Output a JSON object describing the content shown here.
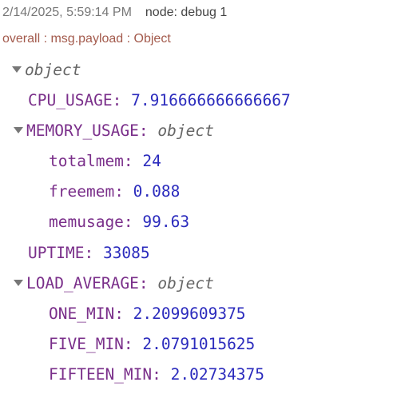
{
  "header": {
    "timestamp": "2/14/2025, 5:59:14 PM",
    "node": "node: debug 1"
  },
  "topic": "overall : msg.payload : Object",
  "payload": {
    "root_type": "object",
    "cpu_usage": {
      "key": "CPU_USAGE",
      "value": "7.916666666666667"
    },
    "memory_usage": {
      "key": "MEMORY_USAGE",
      "type": "object",
      "totalmem": {
        "key": "totalmem",
        "value": "24"
      },
      "freemem": {
        "key": "freemem",
        "value": "0.088"
      },
      "memusage": {
        "key": "memusage",
        "value": "99.63"
      }
    },
    "uptime": {
      "key": "UPTIME",
      "value": "33085"
    },
    "load_average": {
      "key": "LOAD_AVERAGE",
      "type": "object",
      "one_min": {
        "key": "ONE_MIN",
        "value": "2.2099609375"
      },
      "five_min": {
        "key": "FIVE_MIN",
        "value": "2.0791015625"
      },
      "fifteen_min": {
        "key": "FIFTEEN_MIN",
        "value": "2.02734375"
      }
    }
  },
  "colors": {
    "key": "#7a2f8a",
    "number": "#2b2bbd",
    "type": "#666666",
    "topic": "#a35a4c",
    "meta": "#777777"
  },
  "icons": {
    "expand": "caret-down-icon"
  }
}
